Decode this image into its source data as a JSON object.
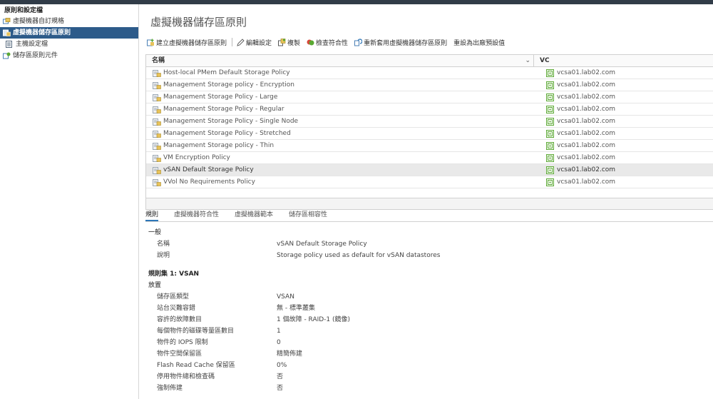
{
  "sidebar": {
    "header": "原則和設定檔",
    "items": [
      {
        "label": "虛擬機器自訂規格",
        "selected": false,
        "sub": false
      },
      {
        "label": "虛擬機器儲存區原則",
        "selected": true,
        "sub": false
      },
      {
        "label": "主機設定檔",
        "selected": false,
        "sub": true
      },
      {
        "label": "儲存區原則元件",
        "selected": false,
        "sub": false
      }
    ]
  },
  "page": {
    "title": "虛擬機器儲存區原則"
  },
  "toolbar": {
    "create": "建立虛擬機器儲存區原則",
    "edit": "編輯設定",
    "clone": "複製",
    "check": "檢查符合性",
    "reapply": "重新套用虛擬機器儲存區原則",
    "reset": "重設為出廠預設值"
  },
  "grid": {
    "col_name": "名稱",
    "col_vc": "VC",
    "rows": [
      {
        "name": "Host-local PMem Default Storage Policy",
        "vc": "vcsa01.lab02.com"
      },
      {
        "name": "Management Storage policy - Encryption",
        "vc": "vcsa01.lab02.com"
      },
      {
        "name": "Management Storage Policy - Large",
        "vc": "vcsa01.lab02.com"
      },
      {
        "name": "Management Storage Policy - Regular",
        "vc": "vcsa01.lab02.com"
      },
      {
        "name": "Management Storage Policy - Single Node",
        "vc": "vcsa01.lab02.com"
      },
      {
        "name": "Management Storage Policy - Stretched",
        "vc": "vcsa01.lab02.com"
      },
      {
        "name": "Management Storage policy - Thin",
        "vc": "vcsa01.lab02.com"
      },
      {
        "name": "VM Encryption Policy",
        "vc": "vcsa01.lab02.com"
      },
      {
        "name": "vSAN Default Storage Policy",
        "vc": "vcsa01.lab02.com"
      },
      {
        "name": "VVol No Requirements Policy",
        "vc": "vcsa01.lab02.com"
      }
    ]
  },
  "tabs": [
    "規則",
    "虛擬機器符合性",
    "虛擬機器範本",
    "儲存區相容性"
  ],
  "details": {
    "general_title": "一般",
    "name_label": "名稱",
    "name_value": "vSAN Default Storage Policy",
    "desc_label": "說明",
    "desc_value": "Storage policy used as default for vSAN datastores",
    "ruleset_title": "規則集 1: VSAN",
    "placement_title": "放置",
    "rules": [
      {
        "k": "儲存區類型",
        "v": "VSAN"
      },
      {
        "k": "站台災難容錯",
        "v": "無 - 標準叢集"
      },
      {
        "k": "容許的故障數目",
        "v": "1 個故障 - RAID-1 (鏡像)"
      },
      {
        "k": "每個物件的磁碟等量區數目",
        "v": "1"
      },
      {
        "k": "物件的 IOPS 限制",
        "v": "0"
      },
      {
        "k": "物件空間保留區",
        "v": "精簡佈建"
      },
      {
        "k": "Flash Read Cache 保留區",
        "v": "0%"
      },
      {
        "k": "停用物件總和檢查碼",
        "v": "否"
      },
      {
        "k": "強制佈建",
        "v": "否"
      }
    ]
  },
  "colors": {
    "selected": "#2d5b8a",
    "vc_green": "#5aa832",
    "accent": "#2d76b8"
  }
}
